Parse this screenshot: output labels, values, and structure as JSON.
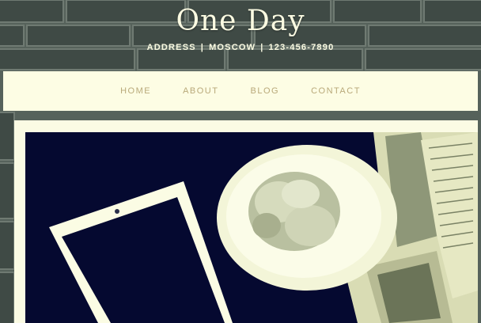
{
  "header": {
    "title": "One Day",
    "address": "ADDRESS",
    "city": "MOSCOW",
    "phone": "123-456-7890",
    "separator": "|"
  },
  "nav": {
    "items": [
      {
        "label": "HOME"
      },
      {
        "label": "ABOUT"
      },
      {
        "label": "BLOG"
      },
      {
        "label": "CONTACT"
      }
    ]
  },
  "colors": {
    "header_text": "#fbfbe2",
    "nav_background": "#fdfde4",
    "nav_text": "#b9a97a",
    "brick": "#4a5650"
  }
}
